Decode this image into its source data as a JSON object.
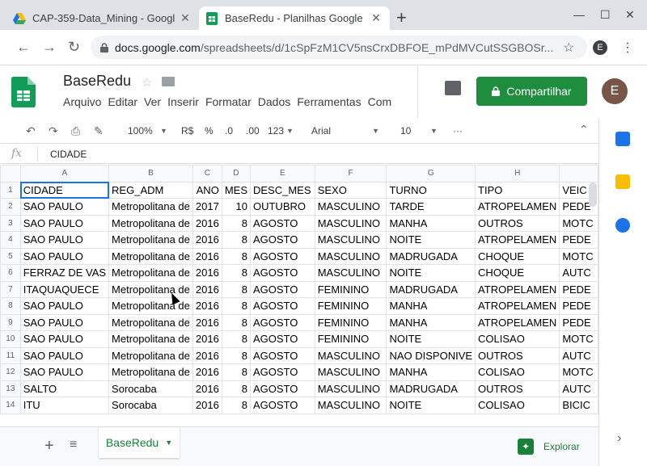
{
  "browser": {
    "tabs": [
      {
        "title": "CAP-359-Data_Mining - Googl",
        "active": false
      },
      {
        "title": "BaseRedu - Planilhas Google",
        "active": true
      }
    ],
    "url_host": "docs.google.com",
    "url_path": "/spreadsheets/d/1cSpFzM1CV5nsCrxDBFOE_mPdMVCutSSGBOSr...",
    "profile_initial": "E"
  },
  "doc": {
    "title": "BaseRedu",
    "menu": [
      "Arquivo",
      "Editar",
      "Ver",
      "Inserir",
      "Formatar",
      "Dados",
      "Ferramentas",
      "Com"
    ],
    "share_label": "Compartilhar",
    "avatar_initial": "E"
  },
  "toolbar": {
    "zoom": "100%",
    "currency": "R$",
    "percent": "%",
    "dec_less": ".0",
    "dec_more": ".00",
    "more_formats": "123",
    "font": "Arial",
    "font_size": "10",
    "more": "···"
  },
  "formula": {
    "fx": "fx",
    "value": "CIDADE"
  },
  "grid": {
    "columns": [
      "A",
      "B",
      "C",
      "D",
      "E",
      "F",
      "G",
      "H",
      ""
    ],
    "rows": [
      {
        "n": "1",
        "cells": [
          "CIDADE",
          "REG_ADM",
          "ANO",
          "MES",
          "DESC_MES",
          "SEXO",
          "TURNO",
          "TIPO",
          "VEIC"
        ]
      },
      {
        "n": "2",
        "cells": [
          "SAO PAULO",
          "Metropolitana de",
          "2017",
          "10",
          "OUTUBRO",
          "MASCULINO",
          "TARDE",
          "ATROPELAMEN",
          "PEDE"
        ]
      },
      {
        "n": "3",
        "cells": [
          "SAO PAULO",
          "Metropolitana de",
          "2016",
          "8",
          "AGOSTO",
          "MASCULINO",
          "MANHA",
          "OUTROS",
          "MOTC"
        ]
      },
      {
        "n": "4",
        "cells": [
          "SAO PAULO",
          "Metropolitana de",
          "2016",
          "8",
          "AGOSTO",
          "MASCULINO",
          "NOITE",
          "ATROPELAMEN",
          "PEDE"
        ]
      },
      {
        "n": "5",
        "cells": [
          "SAO PAULO",
          "Metropolitana de",
          "2016",
          "8",
          "AGOSTO",
          "MASCULINO",
          "MADRUGADA",
          "CHOQUE",
          "MOTC"
        ]
      },
      {
        "n": "6",
        "cells": [
          "FERRAZ DE VAS",
          "Metropolitana de",
          "2016",
          "8",
          "AGOSTO",
          "MASCULINO",
          "NOITE",
          "CHOQUE",
          "AUTC"
        ]
      },
      {
        "n": "7",
        "cells": [
          "ITAQUAQUECE",
          "Metropolitana de",
          "2016",
          "8",
          "AGOSTO",
          "FEMININO",
          "MADRUGADA",
          "ATROPELAMEN",
          "PEDE"
        ]
      },
      {
        "n": "8",
        "cells": [
          "SAO PAULO",
          "Metropolitana de",
          "2016",
          "8",
          "AGOSTO",
          "FEMININO",
          "MANHA",
          "ATROPELAMEN",
          "PEDE"
        ]
      },
      {
        "n": "9",
        "cells": [
          "SAO PAULO",
          "Metropolitana de",
          "2016",
          "8",
          "AGOSTO",
          "FEMININO",
          "MANHA",
          "ATROPELAMEN",
          "PEDE"
        ]
      },
      {
        "n": "10",
        "cells": [
          "SAO PAULO",
          "Metropolitana de",
          "2016",
          "8",
          "AGOSTO",
          "FEMININO",
          "NOITE",
          "COLISAO",
          "MOTC"
        ]
      },
      {
        "n": "11",
        "cells": [
          "SAO PAULO",
          "Metropolitana de",
          "2016",
          "8",
          "AGOSTO",
          "MASCULINO",
          "NAO DISPONIVE",
          "OUTROS",
          "AUTC"
        ]
      },
      {
        "n": "12",
        "cells": [
          "SAO PAULO",
          "Metropolitana de",
          "2016",
          "8",
          "AGOSTO",
          "MASCULINO",
          "MANHA",
          "COLISAO",
          "MOTC"
        ]
      },
      {
        "n": "13",
        "cells": [
          "SALTO",
          "Sorocaba",
          "2016",
          "8",
          "AGOSTO",
          "MASCULINO",
          "MADRUGADA",
          "OUTROS",
          "AUTC"
        ]
      },
      {
        "n": "14",
        "cells": [
          "ITU",
          "Sorocaba",
          "2016",
          "8",
          "AGOSTO",
          "MASCULINO",
          "NOITE",
          "COLISAO",
          "BICIC"
        ]
      }
    ]
  },
  "bottom": {
    "sheet_tab": "BaseRedu",
    "explore_label": "Explorar"
  },
  "colors": {
    "accent_green": "#1e8e3e",
    "selection_blue": "#1a73e8"
  }
}
